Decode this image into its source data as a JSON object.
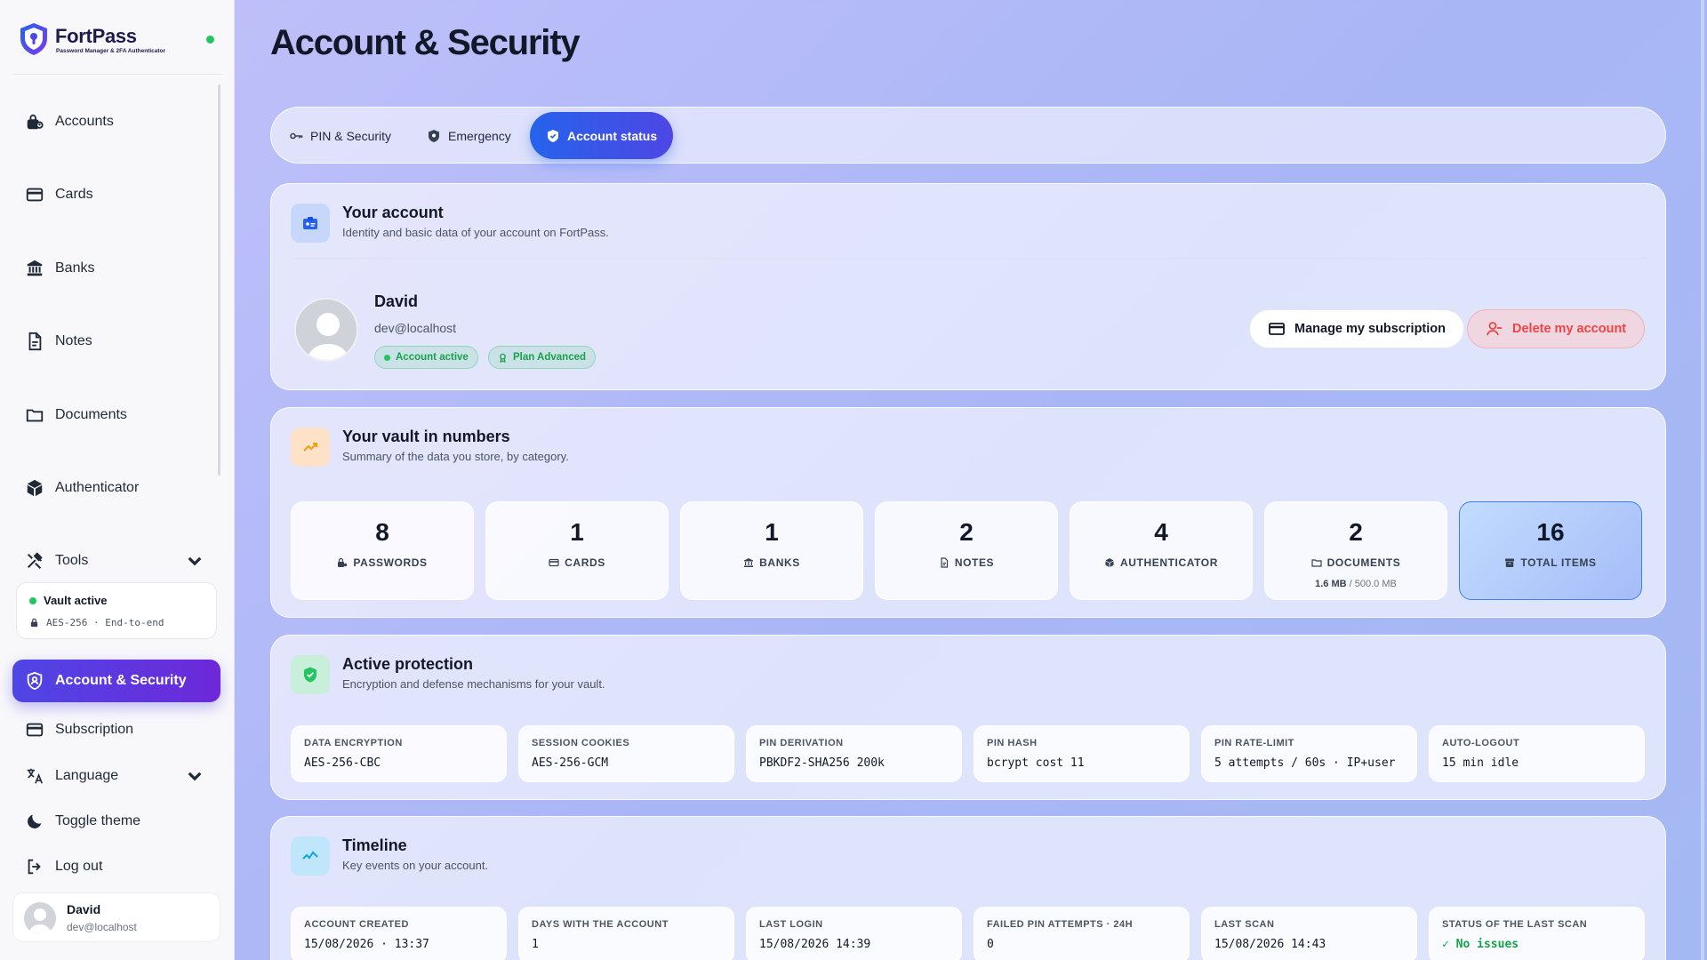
{
  "brand": {
    "name": "FortPass",
    "tagline": "Password Manager & 2FA Authenticator"
  },
  "sidebar": {
    "items": [
      {
        "label": "Accounts",
        "icon": "lock-user-icon"
      },
      {
        "label": "Cards",
        "icon": "credit-card-icon"
      },
      {
        "label": "Banks",
        "icon": "bank-icon"
      },
      {
        "label": "Notes",
        "icon": "note-icon"
      },
      {
        "label": "Documents",
        "icon": "folder-icon"
      },
      {
        "label": "Authenticator",
        "icon": "cube-icon"
      },
      {
        "label": "Tools",
        "icon": "tools-icon"
      }
    ],
    "vault": {
      "title": "Vault active",
      "subtitle": "AES-256 · End-to-end"
    },
    "bottom_items": [
      {
        "label": "Account & Security",
        "icon": "shield-user-icon",
        "active": true
      },
      {
        "label": "Subscription",
        "icon": "credit-card-icon"
      },
      {
        "label": "Language",
        "icon": "translate-icon"
      },
      {
        "label": "Toggle theme",
        "icon": "moon-icon"
      },
      {
        "label": "Log out",
        "icon": "logout-icon"
      }
    ],
    "user": {
      "name": "David",
      "email": "dev@localhost"
    }
  },
  "page": {
    "title": "Account & Security"
  },
  "tabs": [
    {
      "label": "PIN & Security",
      "icon": "key-icon"
    },
    {
      "label": "Emergency",
      "icon": "shield-icon"
    },
    {
      "label": "Account status",
      "icon": "shield-check-icon",
      "active": true
    }
  ],
  "account": {
    "title": "Your account",
    "subtitle": "Identity and basic data of your account on FortPass.",
    "name": "David",
    "email": "dev@localhost",
    "badge_status": "Account active",
    "badge_plan": "Plan Advanced",
    "manage_label": "Manage my subscription",
    "delete_label": "Delete my account"
  },
  "vault_numbers": {
    "title": "Your vault in numbers",
    "subtitle": "Summary of the data you store, by category.",
    "stats": [
      {
        "value": "8",
        "label": "PASSWORDS"
      },
      {
        "value": "1",
        "label": "CARDS"
      },
      {
        "value": "1",
        "label": "BANKS"
      },
      {
        "value": "2",
        "label": "NOTES"
      },
      {
        "value": "4",
        "label": "AUTHENTICATOR"
      },
      {
        "value": "2",
        "label": "DOCUMENTS",
        "used": "1.6 MB",
        "quota": "/ 500.0 MB"
      },
      {
        "value": "16",
        "label": "TOTAL ITEMS"
      }
    ]
  },
  "protection": {
    "title": "Active protection",
    "subtitle": "Encryption and defense mechanisms for your vault.",
    "tiles": [
      {
        "label": "DATA ENCRYPTION",
        "value": "AES-256-CBC"
      },
      {
        "label": "SESSION COOKIES",
        "value": "AES-256-GCM"
      },
      {
        "label": "PIN DERIVATION",
        "value": "PBKDF2-SHA256 200k"
      },
      {
        "label": "PIN HASH",
        "value": "bcrypt cost 11"
      },
      {
        "label": "PIN RATE-LIMIT",
        "value": "5 attempts / 60s · IP+user"
      },
      {
        "label": "AUTO-LOGOUT",
        "value": "15 min idle"
      }
    ]
  },
  "timeline": {
    "title": "Timeline",
    "subtitle": "Key events on your account.",
    "tiles": [
      {
        "label": "ACCOUNT CREATED",
        "value": "15/08/2026 · 13:37"
      },
      {
        "label": "DAYS WITH THE ACCOUNT",
        "value": "1"
      },
      {
        "label": "LAST LOGIN",
        "value": "15/08/2026 14:39"
      },
      {
        "label": "FAILED PIN ATTEMPTS · 24H",
        "value": "0"
      },
      {
        "label": "LAST SCAN",
        "value": "15/08/2026 14:43"
      },
      {
        "label": "STATUS OF THE LAST SCAN",
        "value": "✓ No issues"
      }
    ]
  }
}
